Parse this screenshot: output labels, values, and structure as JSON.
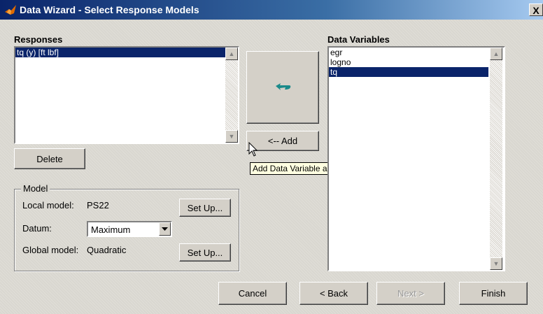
{
  "window": {
    "title": "Data Wizard - Select Response Models",
    "close_label": "X"
  },
  "responses": {
    "heading": "Responses",
    "items": [
      {
        "label": "tq (y) [ft lbf]",
        "selected": true
      }
    ]
  },
  "data_variables": {
    "heading": "Data Variables",
    "items": [
      {
        "label": "egr",
        "selected": false
      },
      {
        "label": "logno",
        "selected": false
      },
      {
        "label": "tq",
        "selected": true
      }
    ]
  },
  "buttons": {
    "delete": "Delete",
    "add": "<-- Add",
    "cancel": "Cancel",
    "back": "< Back",
    "next": "Next >",
    "finish": "Finish",
    "setup_local": "Set Up...",
    "setup_global": "Set Up..."
  },
  "model": {
    "legend": "Model",
    "local_label": "Local model:",
    "local_value": "PS22",
    "datum_label": "Datum:",
    "datum_value": "Maximum",
    "global_label": "Global model:",
    "global_value": "Quadratic"
  },
  "tooltip": "Add Data Variable as New Response",
  "icons": {
    "title_icon": "matlab-logo-icon",
    "arrow_icon": "return-arrow-icon",
    "cursor": "mouse-pointer-icon"
  },
  "colors": {
    "selection": "#0a246a",
    "arrow": "#1a8a8a"
  }
}
